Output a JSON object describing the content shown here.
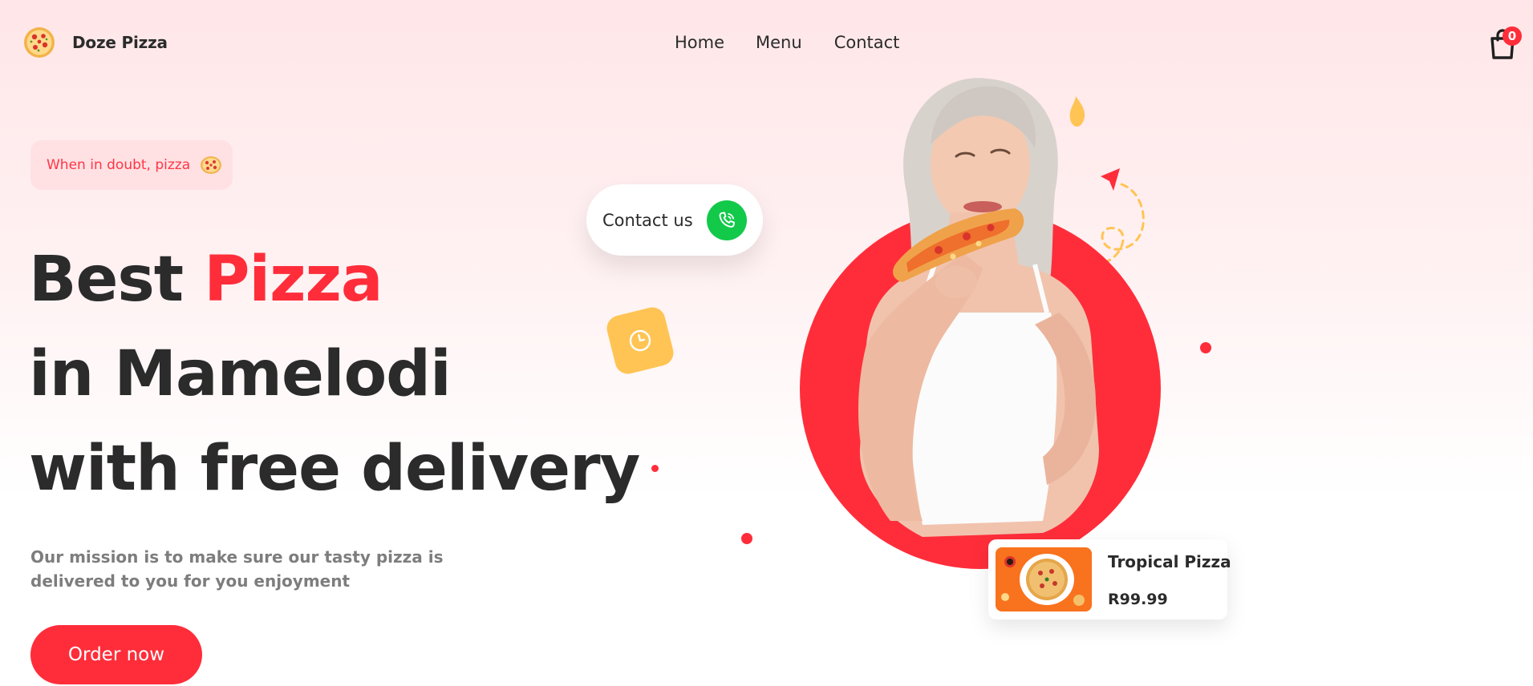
{
  "header": {
    "brand": "Doze Pizza",
    "nav": [
      "Home",
      "Menu",
      "Contact"
    ],
    "cart_count": "0"
  },
  "hero": {
    "tagline": "When in doubt, pizza",
    "headline_word_1": "Best",
    "headline_accent": "Pizza",
    "headline_line_2": "in Mamelodi",
    "headline_line_3": "with free delivery",
    "mission": "Our mission is to make sure our tasty pizza is delivered to you for you enjoyment",
    "order_button": "Order now",
    "contact_button": "Contact us"
  },
  "product": {
    "name": "Tropical Pizza",
    "price": "R99.99"
  },
  "colors": {
    "accent": "#ff2d3a",
    "phone_green": "#12c94a",
    "clock_yellow": "#ffc454",
    "text_dark": "#2b2b2b"
  },
  "icons": [
    "pizza-logo-icon",
    "shopping-bag-icon",
    "pizza-slice-icon",
    "phone-icon",
    "clock-icon",
    "flame-icon",
    "paper-plane-icon"
  ]
}
